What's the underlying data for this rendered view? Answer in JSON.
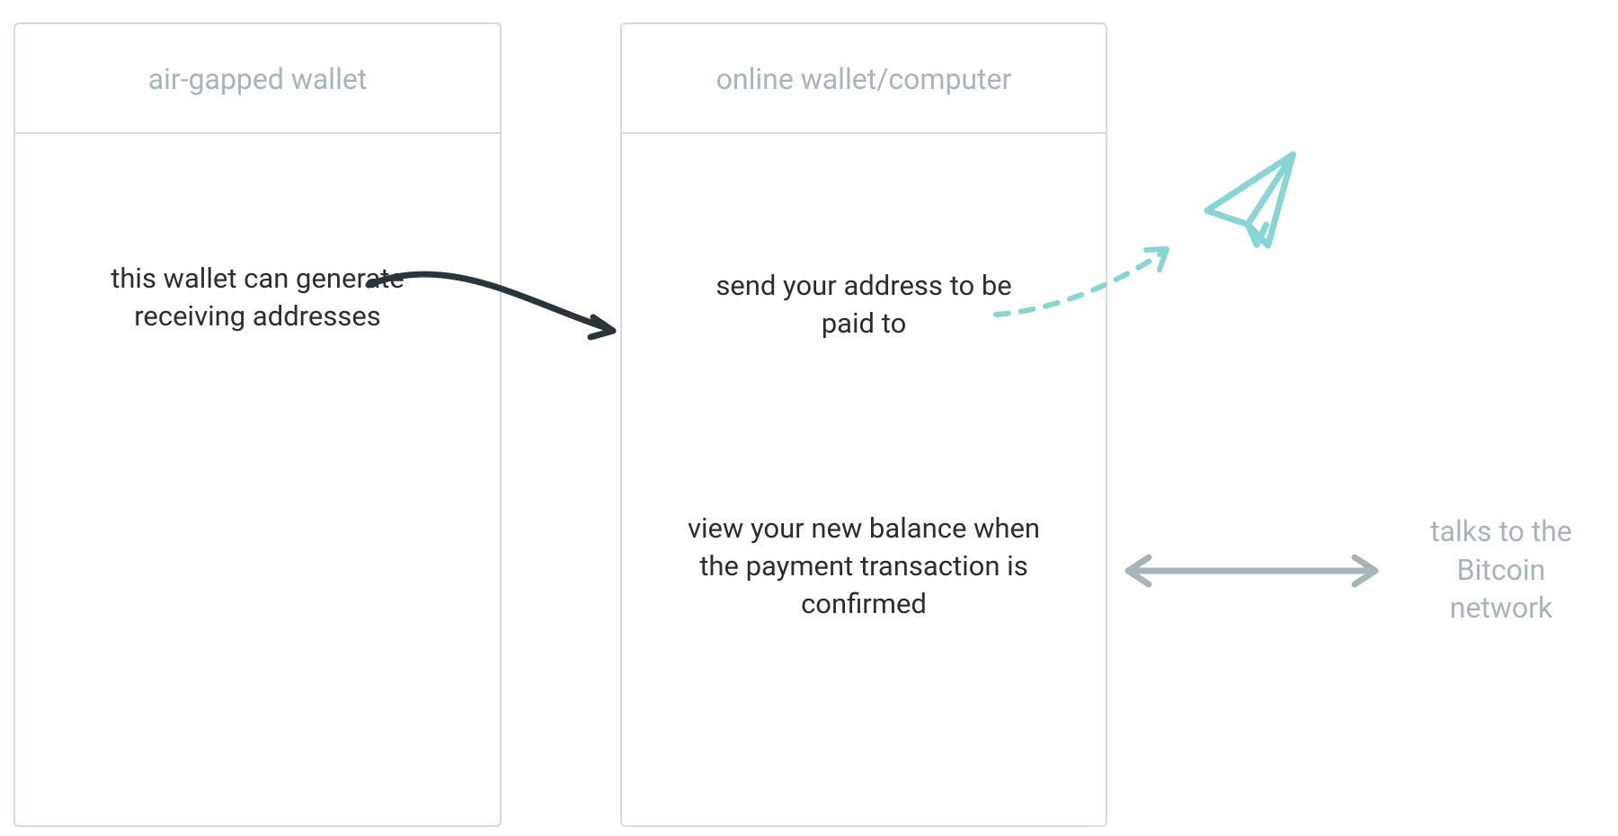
{
  "diagram": {
    "left_box": {
      "title": "air-gapped wallet",
      "body_text": "this wallet can generate receiving addresses"
    },
    "right_box": {
      "title": "online wallet/computer",
      "body_text_1": "send your address to be paid to",
      "body_text_2": "view your new balance when the payment transaction is confirmed"
    },
    "network_text": "talks to the Bitcoin network",
    "colors": {
      "box_border": "#d0dce0",
      "header_text": "#a8b4b8",
      "body_text": "#2a2e30",
      "arrow_dark": "#2a3439",
      "arrow_teal": "#88d5d4",
      "arrow_gray": "#a8b4b8"
    }
  }
}
